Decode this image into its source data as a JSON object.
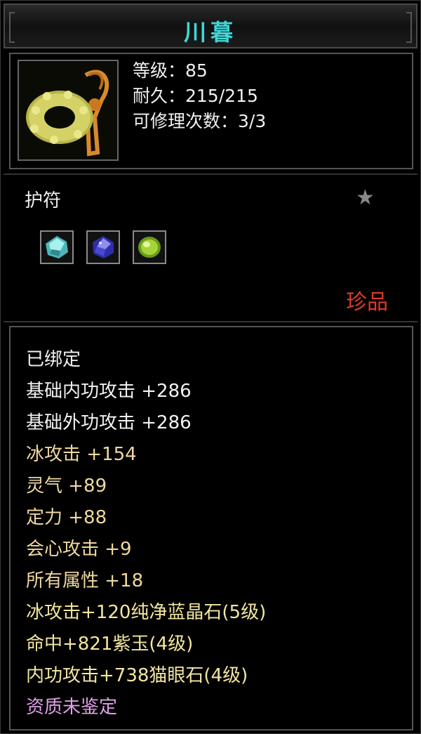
{
  "item": {
    "name": "川暮",
    "level": "等级：85",
    "durability": "耐久：215/215",
    "repairs": "可修理次数：3/3",
    "type": "护符",
    "rarity": "珍品",
    "icon": "jade-amulet-icon",
    "gems": [
      "cyan-crystal-gem-icon",
      "blue-sapphire-gem-icon",
      "green-peridot-gem-icon"
    ]
  },
  "attributes": {
    "bound": "已绑定",
    "base_inner": "基础内功攻击 +286",
    "base_outer": "基础外功攻击 +286",
    "ice_attack": "冰攻击 +154",
    "spirit": "灵气 +89",
    "focus": "定力 +88",
    "crit": "会心攻击 +9",
    "all_attr": "所有属性 +18",
    "gem1": "冰攻击+120纯净蓝晶石(5级)",
    "gem2": "命中+821紫玉(4级)",
    "gem3": "内功攻击+738猫眼石(4级)",
    "quality": "资质未鉴定"
  },
  "colors": {
    "title": "#3fd6d6",
    "rarity": "#e03a2a",
    "attribute_gold": "#f0d8a0",
    "gem_line": "#f3e6a0",
    "quality": "#e0a0e8"
  }
}
